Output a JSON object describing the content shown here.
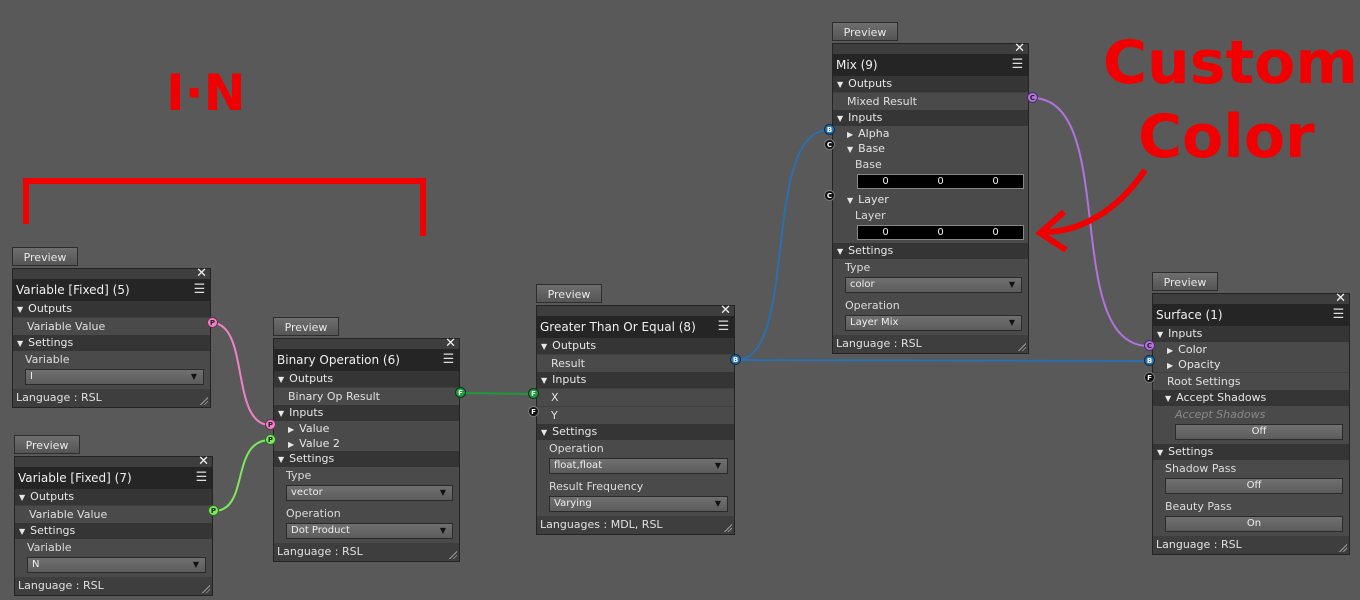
{
  "annotations": {
    "in_label": "I·N",
    "custom_color": [
      "Custom",
      "Color"
    ]
  },
  "common": {
    "preview": "Preview",
    "outputs": "Outputs",
    "inputs": "Inputs",
    "settings": "Settings",
    "language_rsl": "Language : RSL"
  },
  "var5": {
    "title": "Variable [Fixed] (5)",
    "output": "Variable Value",
    "setting_label": "Variable",
    "setting_value": "I",
    "pin": "P"
  },
  "var7": {
    "title": "Variable [Fixed] (7)",
    "output": "Variable Value",
    "setting_label": "Variable",
    "setting_value": "N",
    "pin": "P"
  },
  "binop": {
    "title": "Binary Operation (6)",
    "output": "Binary Op Result",
    "input1": "Value",
    "input2": "Value 2",
    "type_label": "Type",
    "type_value": "vector",
    "op_label": "Operation",
    "op_value": "Dot Product",
    "pin_out": "F",
    "pin_in1": "P",
    "pin_in2": "P"
  },
  "gte": {
    "title": "Greater Than Or Equal (8)",
    "output": "Result",
    "input_x": "X",
    "input_y": "Y",
    "op_label": "Operation",
    "op_value": "float,float",
    "freq_label": "Result Frequency",
    "freq_value": "Varying",
    "languages": "Languages : MDL, RSL",
    "pin_out": "B",
    "pin_x": "F",
    "pin_y": "F"
  },
  "mix": {
    "title": "Mix (9)",
    "output": "Mixed Result",
    "alpha": "Alpha",
    "base": "Base",
    "base_label": "Base",
    "base_values": [
      "0",
      "0",
      "0"
    ],
    "layer": "Layer",
    "layer_label": "Layer",
    "layer_values": [
      "0",
      "0",
      "0"
    ],
    "type_label": "Type",
    "type_value": "color",
    "op_label": "Operation",
    "op_value": "Layer Mix",
    "pin_out": "C",
    "pin_alpha": "B",
    "pin_base": "C",
    "pin_layer": "C"
  },
  "surface": {
    "title": "Surface (1)",
    "color": "Color",
    "opacity": "Opacity",
    "root": "Root Settings",
    "accept_shadows": "Accept Shadows",
    "accept_shadows_label": "Accept Shadows",
    "accept_shadows_value": "Off",
    "shadow_pass_label": "Shadow Pass",
    "shadow_pass_value": "Off",
    "beauty_pass_label": "Beauty Pass",
    "beauty_pass_value": "On",
    "pin_color": "C",
    "pin_opacity": "B",
    "pin_root": "F"
  },
  "colors": {
    "annotation_red": "#f00000",
    "wire_pink": "#ef82c4",
    "wire_green_light": "#7de860",
    "wire_green": "#1e9a3e",
    "wire_blue": "#2a6fb0",
    "wire_purple": "#b073e0"
  }
}
